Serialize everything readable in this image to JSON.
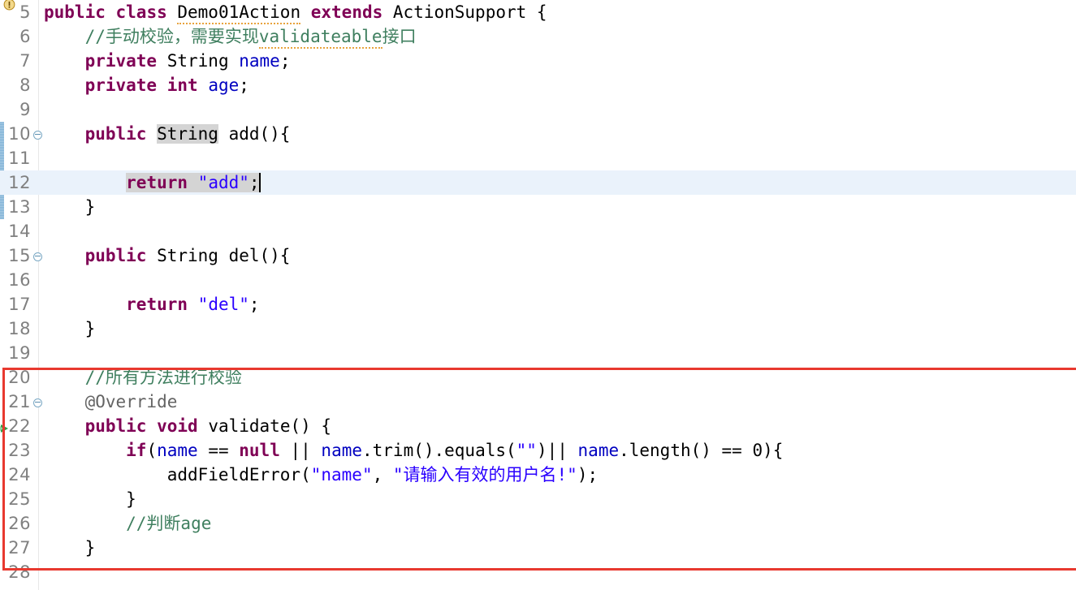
{
  "editor": {
    "type": "java-source-editor",
    "language": "Java",
    "first_visible_line": 5,
    "last_visible_line": 28,
    "current_line": 12,
    "caret_line": 12,
    "selection_text": "return \"add\";",
    "occurrence_highlight": "String",
    "colors": {
      "keyword": "#7f0055",
      "string": "#2a00ff",
      "comment": "#3f7f5f",
      "annotation": "#646464",
      "field": "#0000c0",
      "plain": "#000000",
      "current_line_bg": "#eaf2fb",
      "selection_bg": "#d4d4d4",
      "gutter_text": "#808080",
      "change_bar": "#6ba3cc",
      "annotation_rect": "#e8392f",
      "squiggle": "#e8a33d"
    },
    "annotation_rect": {
      "label": "red-highlight-rectangle",
      "covers_lines": "20-27"
    },
    "change_bar": {
      "label": "change-marker-bar",
      "covers_lines": "10-13"
    },
    "markers": [
      {
        "name": "warning-icon",
        "line": 5,
        "tooltip_kind": "warning"
      },
      {
        "name": "overrides-method-arrow",
        "line": 22,
        "tooltip_kind": "implements"
      }
    ],
    "fold_markers": [
      10,
      15,
      21
    ],
    "lines": [
      {
        "no": "5",
        "tokens": [
          {
            "t": "public ",
            "c": "kw"
          },
          {
            "t": "class ",
            "c": "kw"
          },
          {
            "t": "Demo01Action",
            "c": "plain",
            "squiggle": "warn"
          },
          {
            "t": " ",
            "c": "plain"
          },
          {
            "t": "extends ",
            "c": "kw"
          },
          {
            "t": "ActionSupport {",
            "c": "plain"
          }
        ]
      },
      {
        "no": "6",
        "tokens": [
          {
            "t": "    //手动校验，需要实现",
            "c": "cmt"
          },
          {
            "t": "validateable",
            "c": "cmt",
            "squiggle": "spell"
          },
          {
            "t": "接口",
            "c": "cmt"
          }
        ]
      },
      {
        "no": "7",
        "tokens": [
          {
            "t": "    ",
            "c": "plain"
          },
          {
            "t": "private ",
            "c": "kw"
          },
          {
            "t": "String ",
            "c": "plain"
          },
          {
            "t": "name",
            "c": "field"
          },
          {
            "t": ";",
            "c": "plain"
          }
        ]
      },
      {
        "no": "8",
        "tokens": [
          {
            "t": "    ",
            "c": "plain"
          },
          {
            "t": "private ",
            "c": "kw"
          },
          {
            "t": "int ",
            "c": "kw"
          },
          {
            "t": "age",
            "c": "field"
          },
          {
            "t": ";",
            "c": "plain"
          }
        ]
      },
      {
        "no": "9",
        "tokens": []
      },
      {
        "no": "10",
        "fold": true,
        "tokens": [
          {
            "t": "    ",
            "c": "plain"
          },
          {
            "t": "public ",
            "c": "kw"
          },
          {
            "t": "String",
            "c": "plain",
            "hl": "occur"
          },
          {
            "t": " add(){",
            "c": "plain"
          }
        ]
      },
      {
        "no": "11",
        "tokens": []
      },
      {
        "no": "12",
        "current": true,
        "caret": true,
        "tokens": [
          {
            "t": "        ",
            "c": "plain"
          },
          {
            "t": "return ",
            "c": "kw",
            "hl": "sel"
          },
          {
            "t": "\"add\"",
            "c": "str",
            "hl": "sel"
          },
          {
            "t": ";",
            "c": "plain",
            "hl": "sel"
          }
        ]
      },
      {
        "no": "13",
        "tokens": [
          {
            "t": "    }",
            "c": "plain"
          }
        ]
      },
      {
        "no": "14",
        "tokens": []
      },
      {
        "no": "15",
        "fold": true,
        "tokens": [
          {
            "t": "    ",
            "c": "plain"
          },
          {
            "t": "public ",
            "c": "kw"
          },
          {
            "t": "String del(){",
            "c": "plain"
          }
        ]
      },
      {
        "no": "16",
        "tokens": []
      },
      {
        "no": "17",
        "tokens": [
          {
            "t": "        ",
            "c": "plain"
          },
          {
            "t": "return ",
            "c": "kw"
          },
          {
            "t": "\"del\"",
            "c": "str"
          },
          {
            "t": ";",
            "c": "plain"
          }
        ]
      },
      {
        "no": "18",
        "tokens": [
          {
            "t": "    }",
            "c": "plain"
          }
        ]
      },
      {
        "no": "19",
        "tokens": []
      },
      {
        "no": "20",
        "tokens": [
          {
            "t": "    //所有方法进行校验",
            "c": "cmt"
          }
        ]
      },
      {
        "no": "21",
        "fold": true,
        "tokens": [
          {
            "t": "    @Override",
            "c": "anno"
          }
        ]
      },
      {
        "no": "22",
        "tokens": [
          {
            "t": "    ",
            "c": "plain"
          },
          {
            "t": "public ",
            "c": "kw"
          },
          {
            "t": "void ",
            "c": "kw"
          },
          {
            "t": "validate() {",
            "c": "plain"
          }
        ]
      },
      {
        "no": "23",
        "tokens": [
          {
            "t": "        ",
            "c": "plain"
          },
          {
            "t": "if",
            "c": "kw"
          },
          {
            "t": "(",
            "c": "plain"
          },
          {
            "t": "name",
            "c": "field"
          },
          {
            "t": " == ",
            "c": "plain"
          },
          {
            "t": "null",
            "c": "kw"
          },
          {
            "t": " || ",
            "c": "plain"
          },
          {
            "t": "name",
            "c": "field"
          },
          {
            "t": ".trim().equals(",
            "c": "plain"
          },
          {
            "t": "\"\"",
            "c": "str"
          },
          {
            "t": ")|| ",
            "c": "plain"
          },
          {
            "t": "name",
            "c": "field"
          },
          {
            "t": ".length() == 0){",
            "c": "plain"
          }
        ]
      },
      {
        "no": "24",
        "tokens": [
          {
            "t": "            addFieldError(",
            "c": "plain"
          },
          {
            "t": "\"name\"",
            "c": "str"
          },
          {
            "t": ", ",
            "c": "plain"
          },
          {
            "t": "\"请输入有效的用户名!\"",
            "c": "str"
          },
          {
            "t": ");",
            "c": "plain"
          }
        ]
      },
      {
        "no": "25",
        "tokens": [
          {
            "t": "        }",
            "c": "plain"
          }
        ]
      },
      {
        "no": "26",
        "tokens": [
          {
            "t": "        //判断age",
            "c": "cmt"
          }
        ]
      },
      {
        "no": "27",
        "tokens": [
          {
            "t": "    }",
            "c": "plain"
          }
        ]
      },
      {
        "no": "28",
        "tokens": []
      }
    ]
  }
}
